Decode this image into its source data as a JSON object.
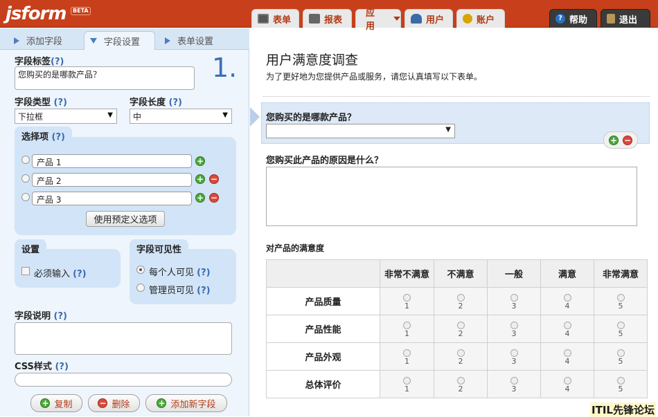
{
  "app": {
    "logo": "jsform",
    "beta": "BETA"
  },
  "nav": {
    "form": "表单",
    "report": "报表",
    "app": "应用",
    "user": "用户",
    "account": "账户",
    "help": "帮助",
    "logout": "退出"
  },
  "left_tabs": {
    "add_field": "添加字段",
    "field_settings": "字段设置",
    "form_settings": "表单设置"
  },
  "field_settings": {
    "label_title": "字段标签",
    "help": "(?)",
    "label_value": "您购买的是哪款产品？",
    "number": "1.",
    "type_title": "字段类型",
    "type_value": "下拉框",
    "length_title": "字段长度",
    "length_value": "中",
    "options_title": "选择项",
    "options": [
      "产品 1",
      "产品 2",
      "产品 3"
    ],
    "predefined_button": "使用预定义选项",
    "settings_title": "设置",
    "required_label": "必须输入",
    "visibility_title": "字段可见性",
    "visible_everyone": "每个人可见",
    "visible_admin": "管理员可见",
    "desc_title": "字段说明",
    "css_title": "CSS样式",
    "copy_button": "复制",
    "delete_button": "删除",
    "add_new_button": "添加新字段"
  },
  "form": {
    "title": "用户满意度调查",
    "description": "为了更好地为您提供产品或服务，请您认真填写以下表单。",
    "q1": "您购买的是哪款产品？",
    "q2": "您购买此产品的原因是什么？",
    "matrix_title": "对产品的满意度",
    "matrix_columns": [
      "非常不满意",
      "不满意",
      "一般",
      "满意",
      "非常满意"
    ],
    "matrix_rows": [
      "产品质量",
      "产品性能",
      "产品外观",
      "总体评价"
    ],
    "matrix_values": [
      "1",
      "2",
      "3",
      "4",
      "5"
    ]
  },
  "watermark": "ITIL先锋论坛"
}
